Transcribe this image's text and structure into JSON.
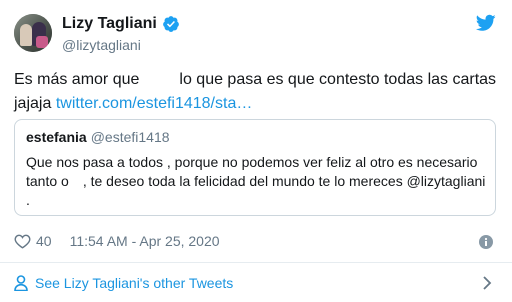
{
  "author": {
    "display_name": "Lizy Tagliani",
    "handle": "@lizytagliani"
  },
  "tweet": {
    "text_part1": "Es más amor que",
    "text_part2": "lo que pasa es que contesto todas las cartas jajaja",
    "link_text": "twitter.com/estefi1418/sta…"
  },
  "quote": {
    "name": "estefania",
    "handle": "@estefi1418",
    "text_part1": "Que nos pasa a todos , porque no podemos ver feliz al otro es necesario tanto o",
    "text_part2": ", te deseo toda la felicidad del mundo te lo mereces @lizytagliani ."
  },
  "meta": {
    "likes": "40",
    "timestamp": "11:54 AM - Apr 25, 2020"
  },
  "footer": {
    "label": "See Lizy Tagliani's other Tweets"
  },
  "colors": {
    "link": "#1b95e0",
    "secondary_text": "#657786",
    "border": "#ccd6dd",
    "twitter_blue": "#1da1f2"
  },
  "icons": [
    "verified-icon",
    "twitter-icon",
    "heart-icon",
    "info-icon",
    "person-icon",
    "chevron-right-icon"
  ]
}
